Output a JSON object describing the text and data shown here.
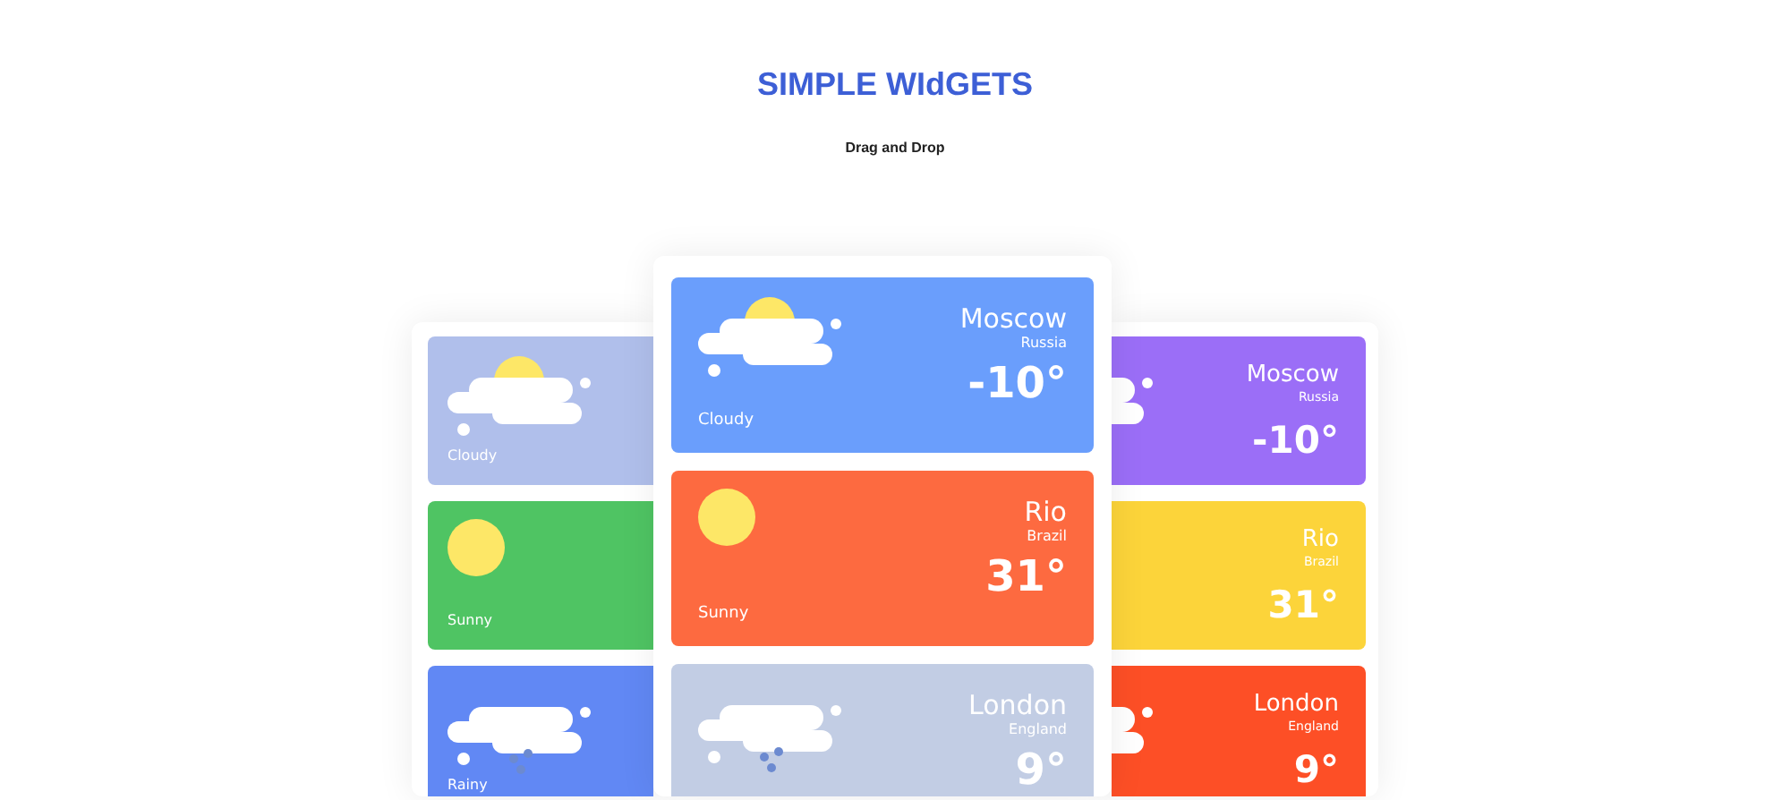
{
  "title": "SIMPLE WIdGETS",
  "subtitle": "Drag and Drop",
  "columns": [
    {
      "cards": [
        {
          "kind": "cloudy",
          "color": "#b0bfeb",
          "condition": "Cloudy"
        },
        {
          "kind": "sunny",
          "color": "#4fc463",
          "condition": "Sunny"
        },
        {
          "kind": "rainy",
          "color": "#6188f4",
          "condition": "Rainy"
        }
      ]
    },
    {
      "cards": [
        {
          "kind": "cloudy",
          "color": "#6a9efc",
          "condition": "Cloudy",
          "city": "Moscow",
          "country": "Russia",
          "temp": "-10°"
        },
        {
          "kind": "sunny",
          "color": "#fd6a40",
          "condition": "Sunny",
          "city": "Rio",
          "country": "Brazil",
          "temp": "31°"
        },
        {
          "kind": "rainy",
          "color": "#c2cde4",
          "city": "London",
          "country": "England",
          "temp": "9°"
        }
      ]
    },
    {
      "cards": [
        {
          "kind": "cloudy",
          "color": "#9b6ef7",
          "city": "Moscow",
          "country": "Russia",
          "temp": "-10°"
        },
        {
          "color": "#fcd43a",
          "city": "Rio",
          "country": "Brazil",
          "temp": "31°"
        },
        {
          "kind": "rainy",
          "color": "#fd4f26",
          "city": "London",
          "country": "England",
          "temp": "9°"
        }
      ]
    }
  ]
}
